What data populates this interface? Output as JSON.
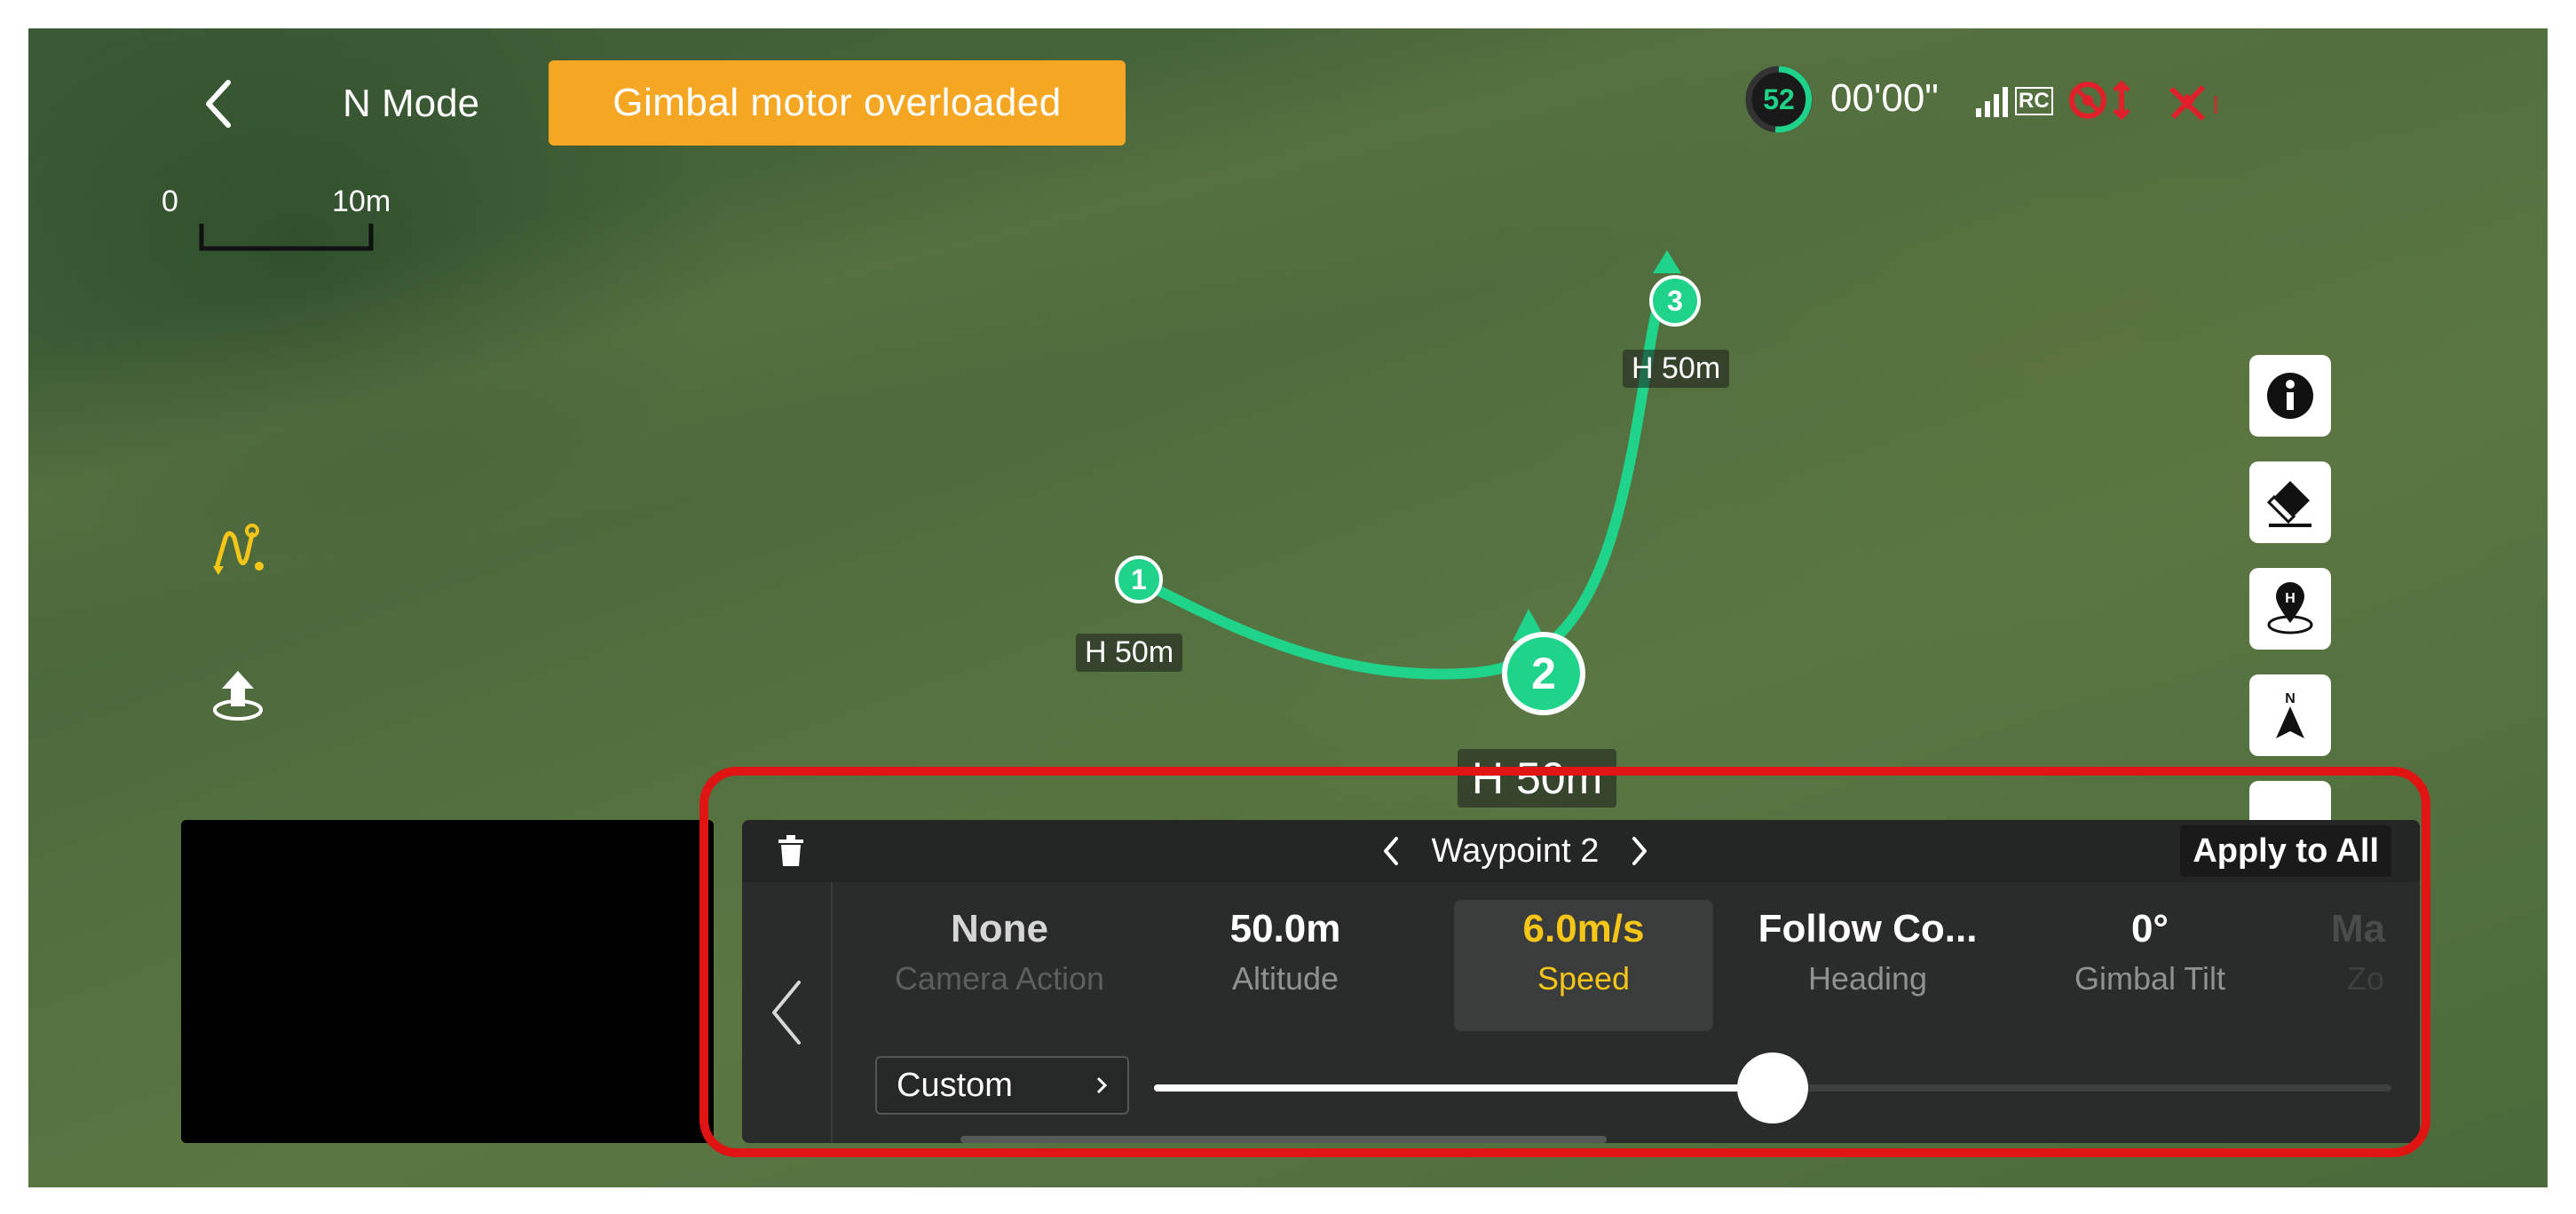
{
  "topbar": {
    "mode_label": "N Mode",
    "warning": "Gimbal motor overloaded",
    "battery_percent": "52",
    "flight_time": "00'00\"",
    "signal_label": "RC"
  },
  "map": {
    "scale_start": "0",
    "scale_end": "10m",
    "waypoints": [
      {
        "number": "1",
        "height_label": "H 50m"
      },
      {
        "number": "2",
        "height_label": "H 50m"
      },
      {
        "number": "3",
        "height_label": "H 50m"
      }
    ]
  },
  "side_tools": {
    "icons": [
      "info-icon",
      "eraser-icon",
      "home-point-icon",
      "compass-north-icon"
    ],
    "compass_letter": "N",
    "home_letter": "H"
  },
  "panel": {
    "title": "Waypoint 2",
    "apply_all_label": "Apply to All",
    "params": [
      {
        "value": "None",
        "label": "Camera Action"
      },
      {
        "value": "50.0m",
        "label": "Altitude"
      },
      {
        "value": "6.0m/s",
        "label": "Speed"
      },
      {
        "value": "Follow Co...",
        "label": "Heading"
      },
      {
        "value": "0°",
        "label": "Gimbal Tilt"
      },
      {
        "value": "Ma",
        "label": "Zo"
      }
    ],
    "selected_param": "Speed",
    "custom_label": "Custom",
    "slider_fraction": 0.5
  },
  "colors": {
    "route": "#1fd38a",
    "warning": "#f5a623",
    "active": "#f5c518",
    "highlight_outline": "#e11414"
  }
}
